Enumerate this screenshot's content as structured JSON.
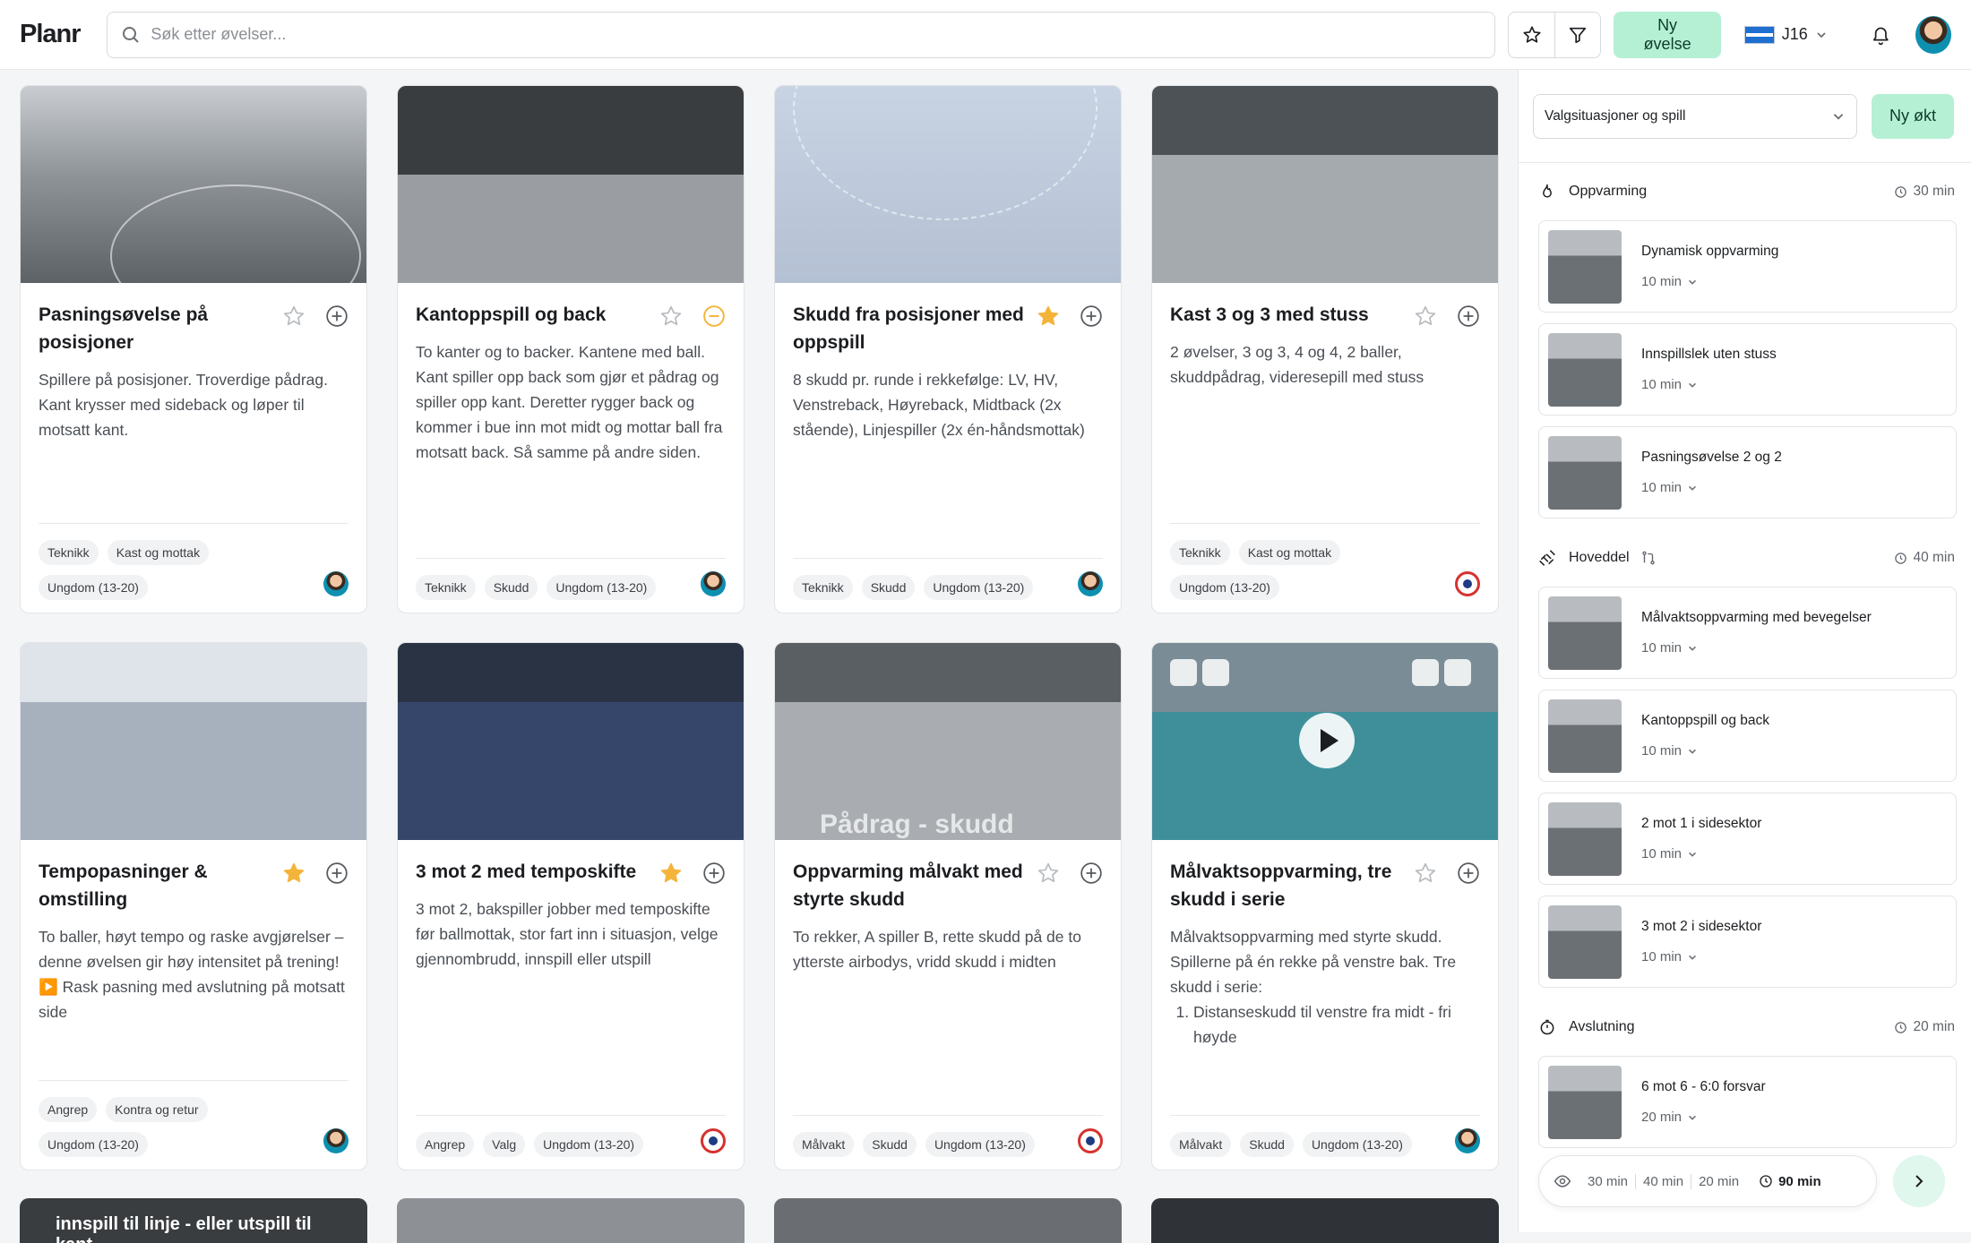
{
  "app": {
    "logo": "Planr"
  },
  "search": {
    "placeholder": "Søk etter øvelser..."
  },
  "header": {
    "new_exercise": "Ny øvelse",
    "team": "J16"
  },
  "cards": [
    {
      "title": "Pasningsøvelse på posisjoner",
      "desc": "Spillere på posisjoner. Troverdige pådrag. Kant krysser med sideback og løper til motsatt kant.",
      "tags": [
        "Teknikk",
        "Kast og mottak",
        "Ungdom (13-20)"
      ],
      "favorite": false,
      "added": false
    },
    {
      "title": "Kantoppspill og back",
      "desc": "To kanter og to backer. Kantene med ball. Kant spiller opp back som gjør et pådrag og spiller opp kant. Deretter rygger back og kommer i bue inn mot midt og mottar ball fra motsatt back. Så samme på andre siden.",
      "tags": [
        "Teknikk",
        "Skudd",
        "Ungdom (13-20)"
      ],
      "favorite": false,
      "added": true
    },
    {
      "title": "Skudd fra posisjoner med oppspill",
      "desc": "8 skudd pr. runde i rekkefølge: LV, HV, Venstreback, Høyreback, Midtback (2x stående), Linjespiller (2x én-håndsmottak)",
      "tags": [
        "Teknikk",
        "Skudd",
        "Ungdom (13-20)"
      ],
      "favorite": true,
      "added": false
    },
    {
      "title": "Kast 3 og 3 med stuss",
      "desc": "2 øvelser, 3 og 3, 4 og 4, 2 baller, skuddpådrag, videresepill med stuss",
      "tags": [
        "Teknikk",
        "Kast og mottak",
        "Ungdom (13-20)"
      ],
      "favorite": false,
      "added": false
    },
    {
      "title": "Tempopasninger & omstilling",
      "desc": "To baller, høyt tempo og raske avgjørelser – denne øvelsen gir høy intensitet på trening!",
      "desc2": "▶️ Rask pasning med avslutning på motsatt side",
      "tags": [
        "Angrep",
        "Kontra og retur",
        "Ungdom (13-20)"
      ],
      "favorite": true,
      "added": false
    },
    {
      "title": "3 mot 2 med temposkifte",
      "desc": "3 mot 2, bakspiller jobber med temposkifte før ballmottak, stor fart inn i situasjon, velge gjennombrudd, innspill eller utspill",
      "tags": [
        "Angrep",
        "Valg",
        "Ungdom (13-20)"
      ],
      "favorite": true,
      "added": false
    },
    {
      "title": "Oppvarming målvakt med styrte skudd",
      "desc": "To rekker, A spiller B, rette skudd på de to ytterste airbodys, vridd skudd i midten",
      "tags": [
        "Målvakt",
        "Skudd",
        "Ungdom (13-20)"
      ],
      "favorite": false,
      "added": false
    },
    {
      "title": "Målvaktsoppvarming, tre skudd i serie",
      "desc": "Målvaktsoppvarming med styrte skudd. Spillerne på én rekke på venstre bak. Tre skudd i serie:",
      "list_item": "Distanseskudd til venstre fra midt - fri høyde",
      "tags": [
        "Målvakt",
        "Skudd",
        "Ungdom (13-20)"
      ],
      "favorite": false,
      "added": false
    }
  ],
  "peek_text": "innspill til linje - eller utspill til kant",
  "thumb_text": "Pådrag - skudd",
  "session": {
    "select_value": "Valgsituasjoner og spill",
    "new_session": "Ny økt",
    "sections": [
      {
        "label": "Oppvarming",
        "duration": "30 min",
        "items": [
          {
            "title": "Dynamisk oppvarming",
            "time": "10 min"
          },
          {
            "title": "Innspillslek uten stuss",
            "time": "10 min"
          },
          {
            "title": "Pasningsøvelse 2 og 2",
            "time": "10 min"
          }
        ]
      },
      {
        "label": "Hoveddel",
        "duration": "40 min",
        "items": [
          {
            "title": "Målvaktsoppvarming med bevegelser",
            "time": "10 min"
          },
          {
            "title": "Kantoppspill og back",
            "time": "10 min"
          },
          {
            "title": "2 mot 1 i sidesektor",
            "time": "10 min"
          },
          {
            "title": "3 mot 2 i sidesektor",
            "time": "10 min"
          }
        ]
      },
      {
        "label": "Avslutning",
        "duration": "20 min",
        "items": [
          {
            "title": "6 mot 6 - 6:0 forsvar",
            "time": "20 min"
          }
        ]
      }
    ],
    "summary": {
      "seg1": "30 min",
      "seg2": "40 min",
      "seg3": "20 min",
      "total": "90 min"
    }
  },
  "colors": {
    "accent": "#b6f0d4",
    "favorite": "#f4b43a",
    "added": "#f4b43a"
  }
}
